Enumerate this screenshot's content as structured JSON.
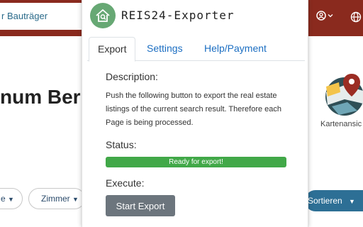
{
  "background_page": {
    "search_text": "r Bauträger",
    "heading": "num Berlin",
    "map_label": "Kartenansic",
    "filter_1": "e",
    "filter_2": "Zimmer",
    "sort_button": "Sortieren"
  },
  "popup": {
    "brand": "REIS24-Exporter",
    "tabs": [
      {
        "label": "Export",
        "active": true
      },
      {
        "label": "Settings",
        "active": false
      },
      {
        "label": "Help/Payment",
        "active": false
      }
    ],
    "description_title": "Description:",
    "description_text": "Push the following button to export the real estate listings of the current search result. Therefore each Page is being processed.",
    "status_title": "Status:",
    "progress": {
      "label": "Ready for export!",
      "fraction": 1.0
    },
    "execute_title": "Execute:",
    "start_button": "Start Export"
  },
  "colors": {
    "header_bg": "#8a2a1e",
    "logo_green": "#67a874",
    "progress_green": "#41a848",
    "tab_link": "#1b6ec2",
    "button_gray": "#6c757d",
    "sort_blue": "#2d6f95"
  },
  "icons": [
    "house-search-icon",
    "user-icon",
    "chevron-down-icon",
    "globe-icon",
    "map-pin-icon"
  ]
}
